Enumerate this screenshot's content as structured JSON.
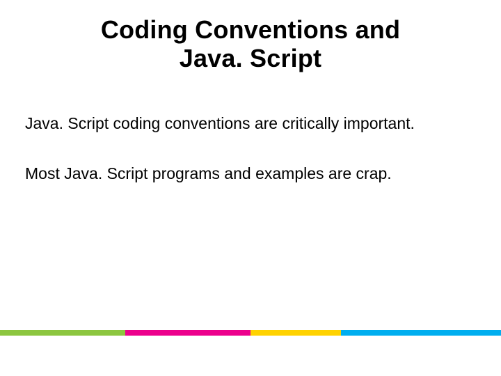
{
  "title_line1": "Coding Conventions and",
  "title_line2": "Java. Script",
  "paragraph1": "Java. Script coding conventions are critically important.",
  "paragraph2": "Most Java. Script programs and examples are crap.",
  "stripe": {
    "segments": [
      {
        "name": "green",
        "width_pct": 25
      },
      {
        "name": "pink",
        "width_pct": 25
      },
      {
        "name": "yellow",
        "width_pct": 18
      },
      {
        "name": "cyan",
        "width_pct": 32
      }
    ],
    "colors": {
      "green": "#8cc63f",
      "pink": "#ec008c",
      "yellow": "#ffd200",
      "cyan": "#00aeef"
    }
  }
}
